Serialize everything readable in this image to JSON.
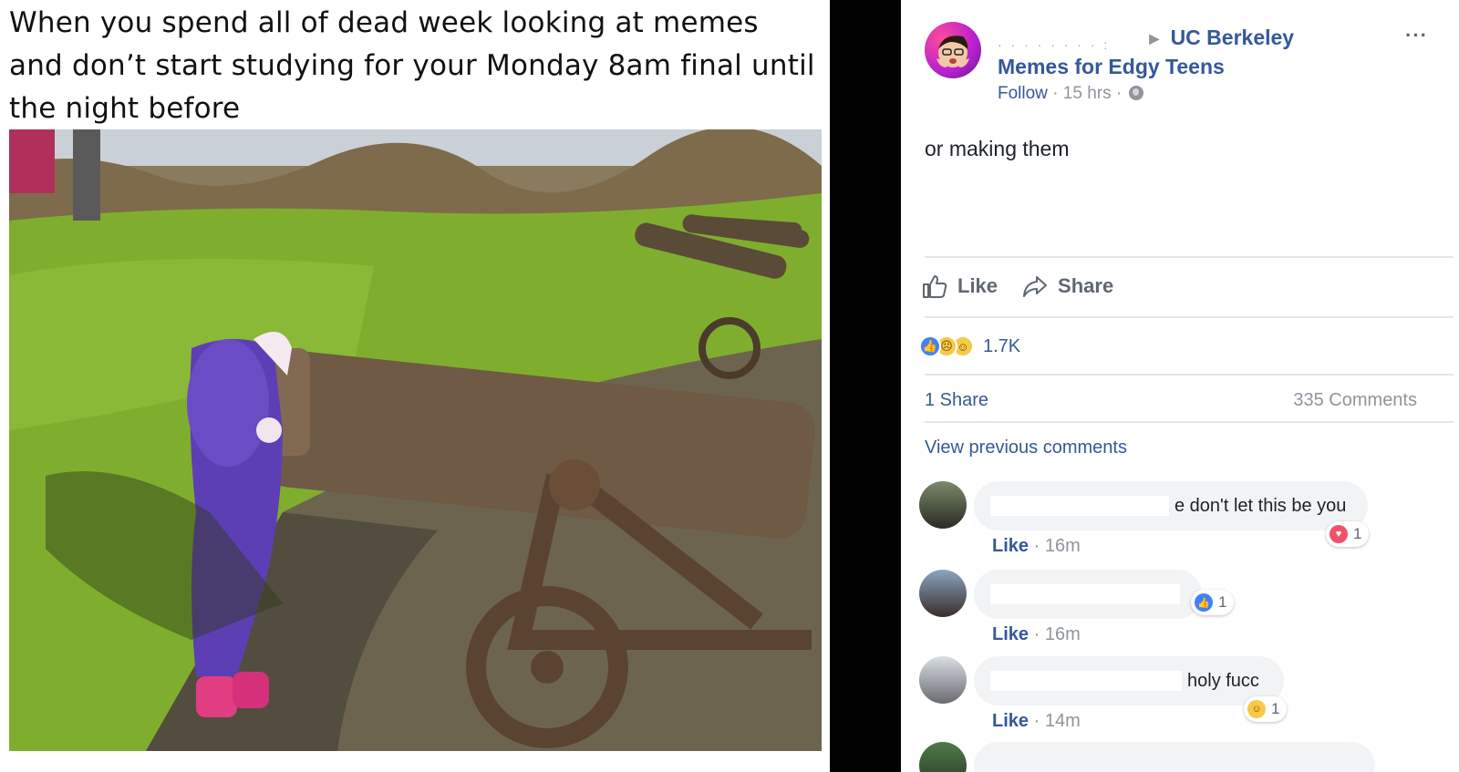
{
  "meme": {
    "caption": "When you spend all of dead week looking at memes and don’t start studying for your Monday 8am final until the night before"
  },
  "post": {
    "author_hidden": "· · · · · · · · :",
    "arrow_icon": "triangle-right",
    "page_name_line1": "UC Berkeley",
    "page_name_line2": "Memes for Edgy Teens",
    "follow_label": "Follow",
    "time": "15 hrs",
    "separator": "·",
    "more_icon": "···",
    "text": "or making them",
    "actions": {
      "like_label": "Like",
      "share_label": "Share"
    },
    "reactions": {
      "icons": [
        "like",
        "sad",
        "haha"
      ],
      "count": "1.7K"
    },
    "shares": "1 Share",
    "comments_count": "335 Comments",
    "view_previous": "View previous comments",
    "comments": [
      {
        "text": "e don't let this be you",
        "like_label": "Like",
        "time": "16m",
        "badge_icon": "love",
        "badge_count": "1"
      },
      {
        "text": "",
        "like_label": "Like",
        "time": "16m",
        "badge_icon": "like",
        "badge_count": "1"
      },
      {
        "text": "holy fucc",
        "like_label": "Like",
        "time": "14m",
        "badge_icon": "haha",
        "badge_count": "1"
      }
    ]
  },
  "colors": {
    "link": "#365899",
    "meta": "#90949c",
    "bubble": "#f2f3f5",
    "like_blue": "#4080ff",
    "love_red": "#f25268"
  }
}
